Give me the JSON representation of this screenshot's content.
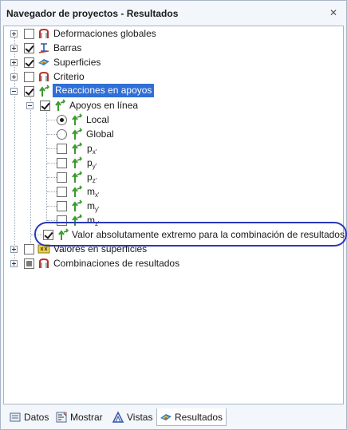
{
  "window": {
    "title": "Navegador de proyectos - Resultados",
    "close_glyph": "✕"
  },
  "tree": [
    {
      "id": "deformaciones",
      "label": "Deformaciones globales",
      "checkbox": "unchecked",
      "icon": "deformation-icon"
    },
    {
      "id": "barras",
      "label": "Barras",
      "checkbox": "checked",
      "icon": "member-icon"
    },
    {
      "id": "superficies",
      "label": "Superficies",
      "checkbox": "checked",
      "icon": "surface-icon"
    },
    {
      "id": "criterio",
      "label": "Criterio",
      "checkbox": "unchecked",
      "icon": "criterion-icon"
    },
    {
      "id": "reacciones",
      "label": "Reacciones en apoyos",
      "checkbox": "checked",
      "icon": "support-reaction-icon",
      "selected": true
    },
    {
      "id": "apoyos-linea",
      "label": "Apoyos en línea",
      "checkbox": "checked",
      "icon": "support-reaction-icon"
    },
    {
      "id": "local",
      "label": "Local",
      "radio": "selected",
      "icon": "support-reaction-icon"
    },
    {
      "id": "global",
      "label": "Global",
      "radio": "unselected",
      "icon": "support-reaction-icon"
    },
    {
      "id": "px",
      "label": "p",
      "sub": "x'",
      "checkbox": "unchecked",
      "icon": "support-reaction-icon"
    },
    {
      "id": "py",
      "label": "p",
      "sub": "y'",
      "checkbox": "unchecked",
      "icon": "support-reaction-icon"
    },
    {
      "id": "pz",
      "label": "p",
      "sub": "z'",
      "checkbox": "unchecked",
      "icon": "support-reaction-icon"
    },
    {
      "id": "mx",
      "label": "m",
      "sub": "x'",
      "checkbox": "unchecked",
      "icon": "support-reaction-icon"
    },
    {
      "id": "my",
      "label": "m",
      "sub": "y'",
      "checkbox": "unchecked",
      "icon": "support-reaction-icon"
    },
    {
      "id": "mz",
      "label": "m",
      "sub": "z'",
      "checkbox": "unchecked",
      "icon": "support-reaction-icon"
    },
    {
      "id": "valor-extremo",
      "label": "Valor absolutamente extremo para la combinación de resultados",
      "checkbox": "checked",
      "icon": "support-reaction-icon"
    },
    {
      "id": "valores-superficies",
      "label": "Valores en superficies",
      "checkbox": "unchecked",
      "icon": "xx-values-icon"
    },
    {
      "id": "combinaciones",
      "label": "Combinaciones de resultados",
      "checkbox": "partial",
      "icon": "combination-icon"
    }
  ],
  "tabs": [
    {
      "label": "Datos",
      "icon": "data-icon"
    },
    {
      "label": "Mostrar",
      "icon": "display-icon"
    },
    {
      "label": "Vistas",
      "icon": "views-icon"
    },
    {
      "label": "Resultados",
      "icon": "results-icon",
      "active": true
    }
  ],
  "colors": {
    "selection": "#2f6fd6",
    "highlight_ellipse": "#2a39b8",
    "support_icon_green": "#3a9a2e"
  }
}
